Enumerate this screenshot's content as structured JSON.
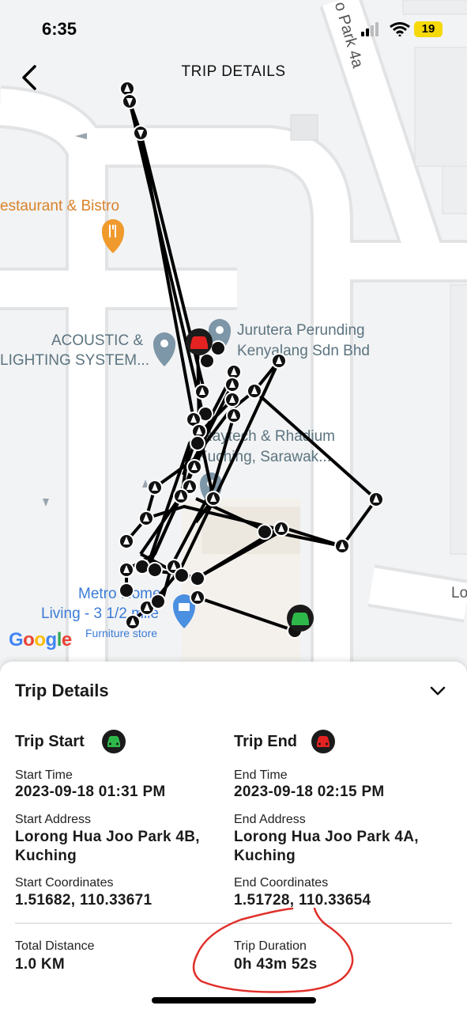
{
  "status_bar": {
    "time": "6:35",
    "battery": "19"
  },
  "header": {
    "title": "TRIP DETAILS"
  },
  "map": {
    "labels": {
      "restaurant": "estaurant & Bistro",
      "acoustic_1": "ACOUSTIC &",
      "acoustic_2": "LIGHTING SYSTEM...",
      "jurutera_1": "Jurutera Perunding",
      "jurutera_2": "Kenyalang Sdn Bhd",
      "raytech_1": "Raytech & Rhadium",
      "raytech_2": "Kuching, Sarawak...",
      "metro_1": "Metro Home",
      "metro_2": "Living - 3 1/2 mile",
      "metro_3": "Furniture store",
      "road_park": "o Park 4a",
      "road_lo": "Lo"
    },
    "logo": "Google"
  },
  "sheet": {
    "title": "Trip Details",
    "start": {
      "heading": "Trip Start",
      "time_label": "Start Time",
      "time_value": "2023-09-18 01:31 PM",
      "address_label": "Start Address",
      "address_line1": "Lorong Hua Joo Park 4B,",
      "address_line2": "Kuching",
      "coords_label": "Start Coordinates",
      "coords_value": "1.51682, 110.33671"
    },
    "end": {
      "heading": "Trip End",
      "time_label": "End Time",
      "time_value": "2023-09-18 02:15 PM",
      "address_label": "End Address",
      "address_line1": "Lorong Hua Joo Park 4A,",
      "address_line2": "Kuching",
      "coords_label": "End Coordinates",
      "coords_value": "1.51728, 110.33654"
    },
    "distance": {
      "label": "Total Distance",
      "value": "1.0 KM"
    },
    "duration": {
      "label": "Trip Duration",
      "value": "0h 43m 52s"
    }
  },
  "colors": {
    "start_car": "#2fb84a",
    "end_car": "#e52222",
    "annotation": "#e0302a"
  },
  "icons": [
    "back-icon",
    "chevron-down-icon",
    "car-icon",
    "pin-icon",
    "fork-knife-icon",
    "shopping-bag-icon"
  ]
}
